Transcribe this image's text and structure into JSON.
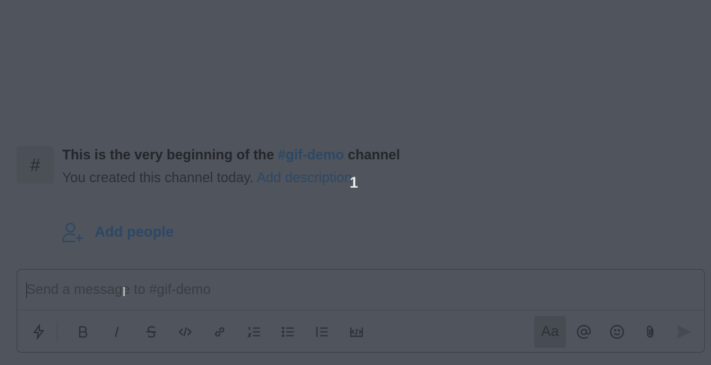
{
  "intro": {
    "title_prefix": "This is the very beginning of the ",
    "channel_name": "#gif-demo",
    "title_suffix": " channel",
    "subtitle": "You created this channel today. ",
    "add_description": "Add description",
    "hash_symbol": "#"
  },
  "overlay": {
    "number": "1"
  },
  "add_people": {
    "label": "Add people"
  },
  "composer": {
    "placeholder": "Send a message to #gif-demo",
    "format_label": "Aa"
  }
}
